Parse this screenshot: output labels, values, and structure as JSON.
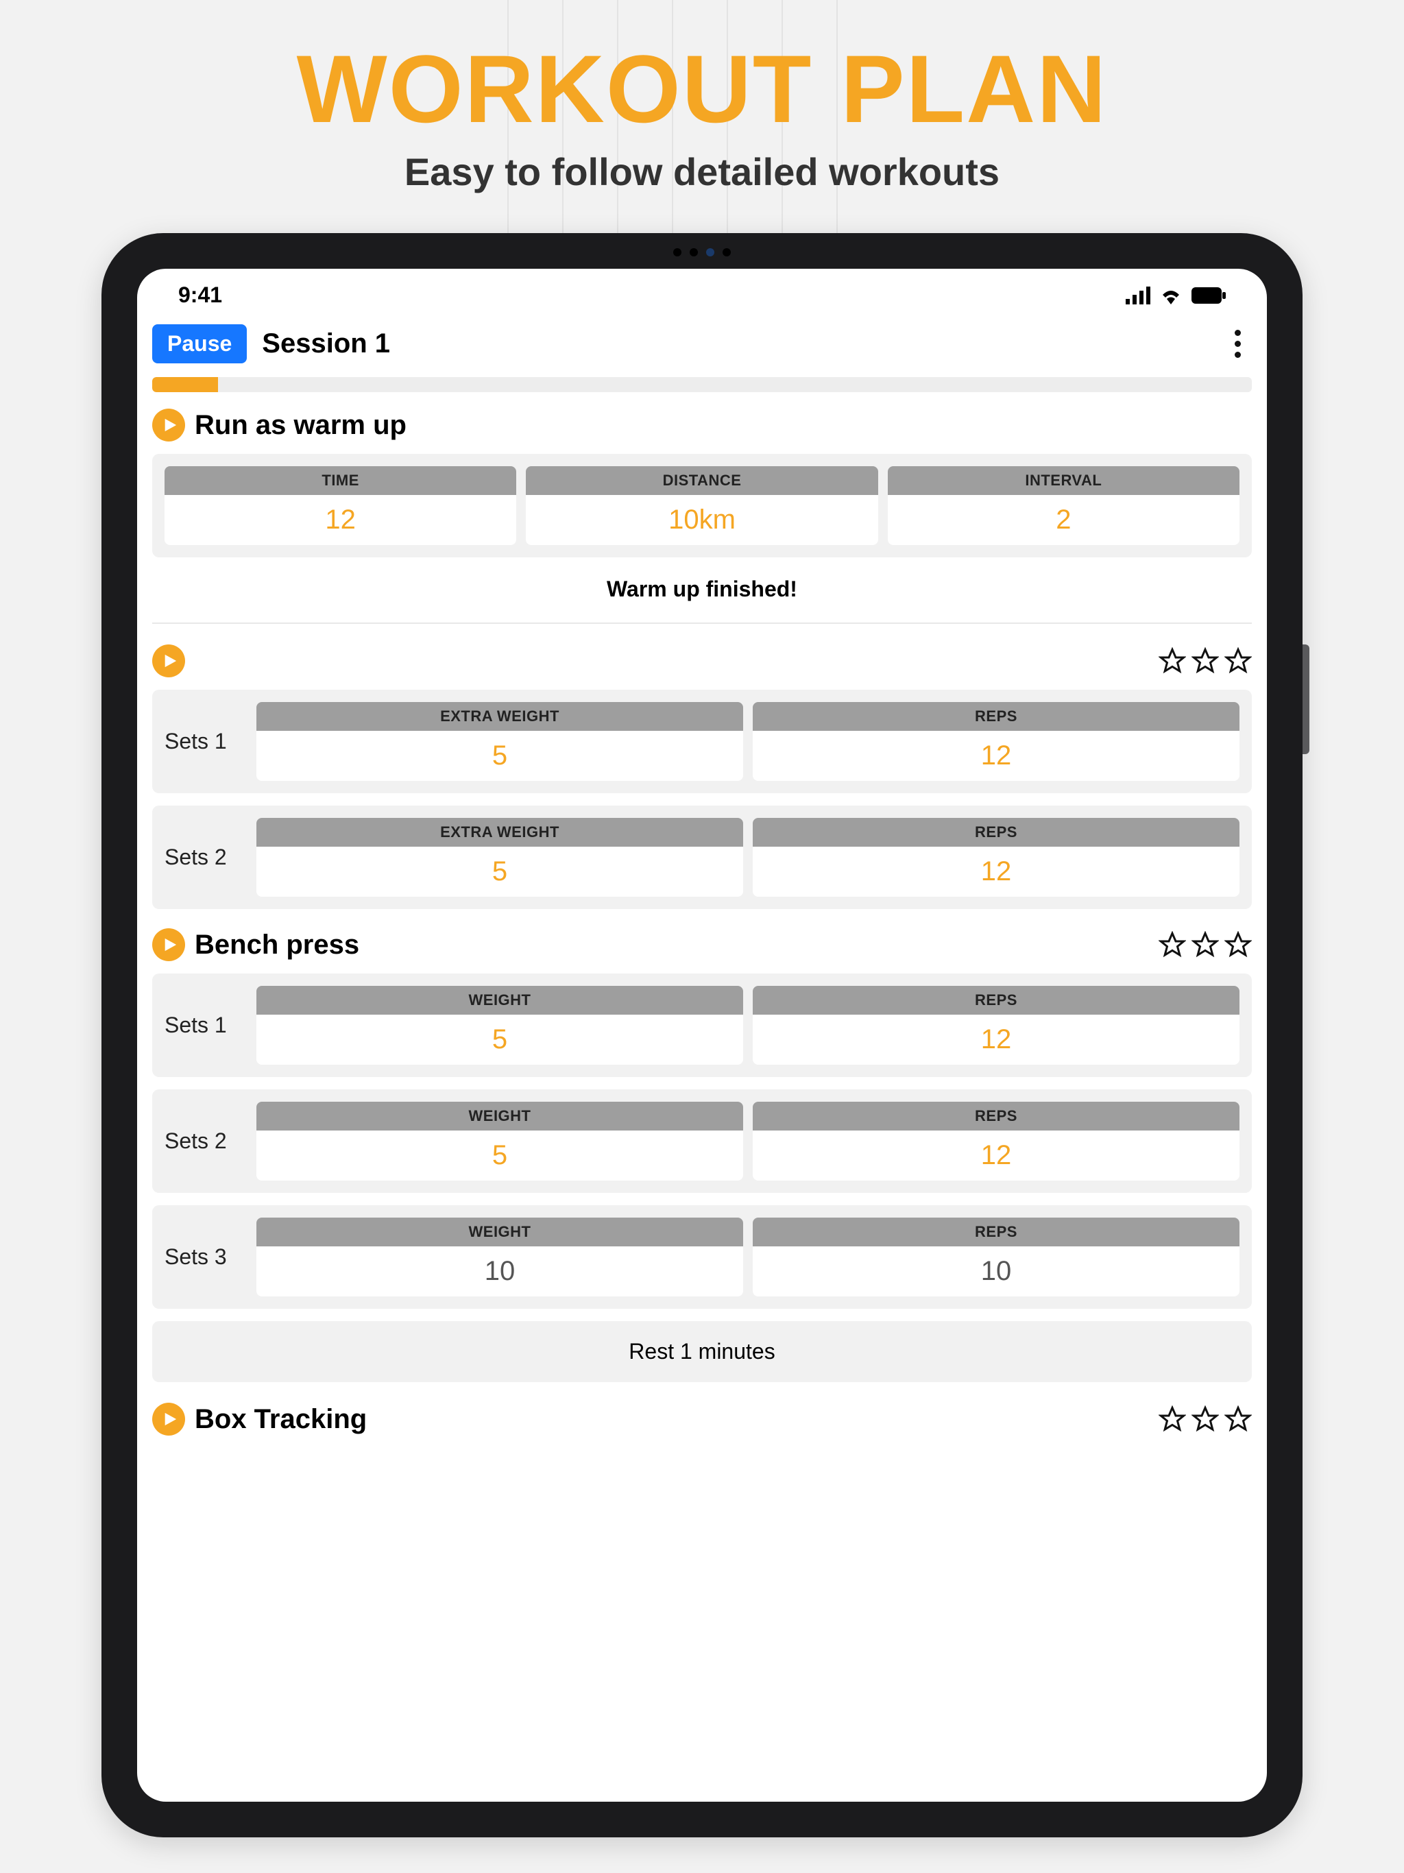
{
  "hero": {
    "title": "WORKOUT PLAN",
    "subtitle": "Easy to follow detailed workouts"
  },
  "status": {
    "time": "9:41"
  },
  "header": {
    "pause_label": "Pause",
    "session_title": "Session 1"
  },
  "progress": {
    "percent": 6
  },
  "sections": [
    {
      "title": "Run as warm up",
      "type": "warmup",
      "metrics": [
        {
          "label": "TIME",
          "value": "12"
        },
        {
          "label": "DISTANCE",
          "value": "10km"
        },
        {
          "label": "INTERVAL",
          "value": "2"
        }
      ],
      "done_text": "Warm up finished!"
    },
    {
      "title": "",
      "type": "exercise",
      "stars": 0,
      "sets": [
        {
          "label": "Sets 1",
          "metrics": [
            {
              "label": "EXTRA WEIGHT",
              "value": "5",
              "active": true
            },
            {
              "label": "REPS",
              "value": "12",
              "active": true
            }
          ]
        },
        {
          "label": "Sets 2",
          "metrics": [
            {
              "label": "EXTRA WEIGHT",
              "value": "5",
              "active": true
            },
            {
              "label": "REPS",
              "value": "12",
              "active": true
            }
          ]
        }
      ]
    },
    {
      "title": "Bench press",
      "type": "exercise",
      "stars": 0,
      "sets": [
        {
          "label": "Sets 1",
          "metrics": [
            {
              "label": "WEIGHT",
              "value": "5",
              "active": true
            },
            {
              "label": "REPS",
              "value": "12",
              "active": true
            }
          ]
        },
        {
          "label": "Sets 2",
          "metrics": [
            {
              "label": "WEIGHT",
              "value": "5",
              "active": true
            },
            {
              "label": "REPS",
              "value": "12",
              "active": true
            }
          ]
        },
        {
          "label": "Sets 3",
          "metrics": [
            {
              "label": "WEIGHT",
              "value": "10",
              "active": false
            },
            {
              "label": "REPS",
              "value": "10",
              "active": false
            }
          ]
        }
      ],
      "rest_text": "Rest 1 minutes"
    },
    {
      "title": "Box Tracking",
      "type": "exercise",
      "stars": 0,
      "sets": []
    }
  ],
  "colors": {
    "accent": "#f5a623",
    "primary": "#1677ff"
  }
}
